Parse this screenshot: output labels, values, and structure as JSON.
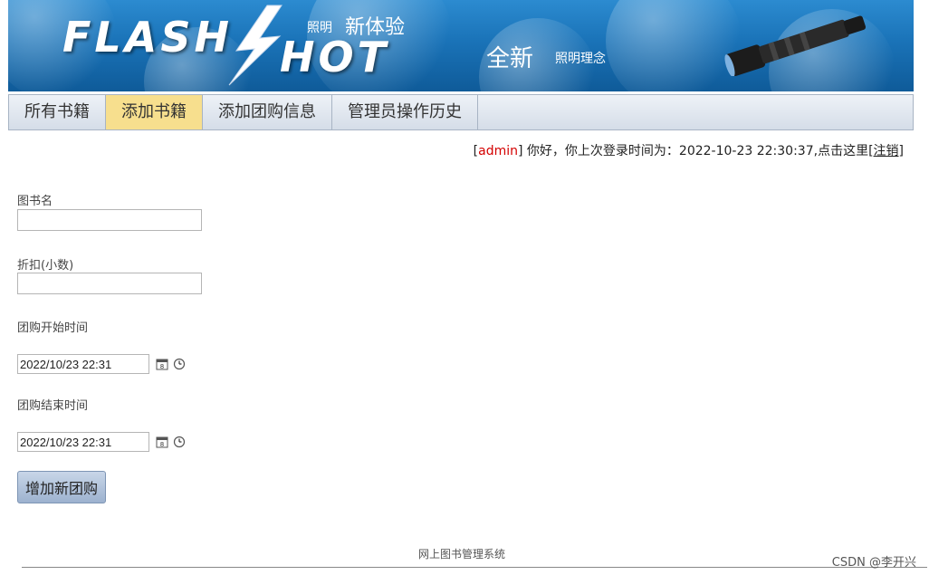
{
  "banner": {
    "logo_part1": "FLASH",
    "logo_part2": "HOT",
    "slogan_small_1": "照明",
    "slogan_big_1": "新体验",
    "slogan_big_2": "全新",
    "slogan_small_2": "照明理念"
  },
  "nav": {
    "tabs": [
      {
        "label": "所有书籍",
        "active": false
      },
      {
        "label": "添加书籍",
        "active": true
      },
      {
        "label": "添加团购信息",
        "active": false
      },
      {
        "label": "管理员操作历史",
        "active": false
      }
    ]
  },
  "user": {
    "bracket_open": "[",
    "name": "admin",
    "greeting": "] 你好，你上次登录时间为：2022-10-23 22:30:37,点击这里[",
    "logout": "注销",
    "bracket_close": "]"
  },
  "form": {
    "book_name_label": "图书名",
    "book_name_value": "",
    "discount_label": "折扣(小数)",
    "discount_value": "",
    "start_label": "团购开始时间",
    "start_value": "2022/10/23 22:31",
    "end_label": "团购结束时间",
    "end_value": "2022/10/23 22:31",
    "submit_label": "增加新团购"
  },
  "footer": {
    "text": "网上图书管理系统",
    "watermark": "CSDN @李开兴"
  },
  "colors": {
    "active_tab": "#f7df8e",
    "admin_name": "#d40000"
  },
  "icons": [
    "calendar-icon",
    "clock-icon",
    "lightning-bolt-icon",
    "flashlight-icon"
  ]
}
